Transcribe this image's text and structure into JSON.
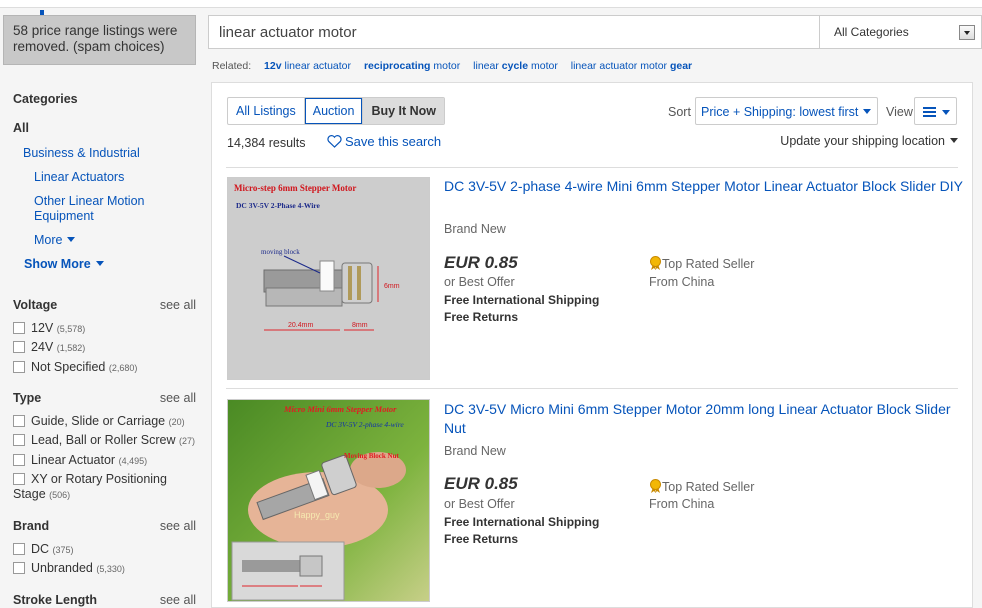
{
  "spam_notice": "58 price range listings were removed. (spam choices)",
  "search": {
    "value": "linear actuator motor",
    "category": "All Categories"
  },
  "related": {
    "label": "Related:",
    "links": [
      {
        "bold": "12v",
        "rest": " linear actuator"
      },
      {
        "bold": "reciprocating",
        "rest": " motor"
      },
      {
        "pre": "linear ",
        "bold": "cycle",
        "rest": " motor"
      },
      {
        "pre": "linear actuator motor ",
        "bold": "gear",
        "rest": ""
      }
    ]
  },
  "sidebar": {
    "categories_title": "Categories",
    "all": "All",
    "business": "Business & Industrial",
    "linear_actuators": "Linear Actuators",
    "other_linear": "Other Linear Motion Equipment",
    "more": "More",
    "show_more": "Show More",
    "see_all": "see all",
    "voltage": {
      "title": "Voltage",
      "items": [
        {
          "label": "12V",
          "count": "(5,578)"
        },
        {
          "label": "24V",
          "count": "(1,582)"
        },
        {
          "label": "Not Specified",
          "count": "(2,680)"
        }
      ]
    },
    "type": {
      "title": "Type",
      "items": [
        {
          "label": "Guide, Slide or Carriage",
          "count": "(20)"
        },
        {
          "label": "Lead, Ball or Roller Screw",
          "count": "(27)"
        },
        {
          "label": "Linear Actuator",
          "count": "(4,495)"
        },
        {
          "label": "XY or Rotary Positioning Stage",
          "count": "(506)"
        }
      ]
    },
    "brand": {
      "title": "Brand",
      "items": [
        {
          "label": "DC",
          "count": "(375)"
        },
        {
          "label": "Unbranded",
          "count": "(5,330)"
        }
      ]
    },
    "stroke": {
      "title": "Stroke Length"
    }
  },
  "toolbar": {
    "tabs": [
      "All Listings",
      "Auction",
      "Buy It Now"
    ],
    "sort_label": "Sort",
    "sort_value": "Price + Shipping: lowest first",
    "view_label": "View",
    "results_count": "14,384 results",
    "save_search": "Save this search",
    "ship_location": "Update your shipping location"
  },
  "listings": [
    {
      "title": "DC 3V-5V 2-phase 4-wire Mini 6mm Stepper Motor Linear Actuator Block Slider DIY",
      "condition": "Brand New",
      "price": "EUR 0.85",
      "offer": "or Best Offer",
      "shipping": "Free International Shipping",
      "returns": "Free Returns",
      "seller": "Top Rated Seller",
      "origin": "From China",
      "img_title": "Micro-step 6mm Stepper Motor",
      "img_sub": "DC 3V-5V   2-Phase 4-Wire",
      "img_block": "moving block",
      "img_len1": "20.4mm",
      "img_len2": "8mm",
      "img_len3": "6mm"
    },
    {
      "title": "DC 3V-5V Micro Mini 6mm Stepper Motor 20mm long Linear Actuator Block Slider Nut",
      "condition": "Brand New",
      "price": "EUR 0.85",
      "offer": "or Best Offer",
      "shipping": "Free International Shipping",
      "returns": "Free Returns",
      "seller": "Top Rated Seller",
      "origin": "From China",
      "img_title": "Micro Mini 6mm Stepper Motor",
      "img_sub": "DC 3V-5V  2-phase 4-wire",
      "img_block": "Moving Block Nut",
      "img_wm": "Happy_guy"
    }
  ],
  "colors": {
    "link": "#0654ba",
    "sidebar_bg": "#f5f5f5",
    "notice_bg": "#c8c8c8"
  }
}
